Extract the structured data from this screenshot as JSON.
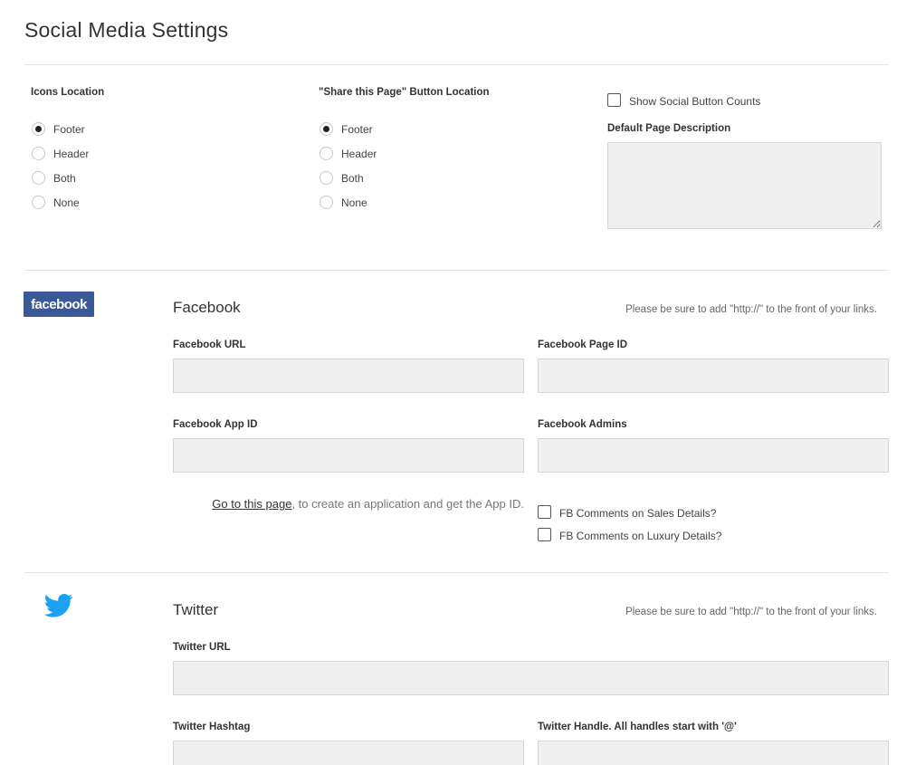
{
  "page": {
    "title": "Social Media Settings"
  },
  "icons_location": {
    "label": "Icons Location",
    "options": [
      "Footer",
      "Header",
      "Both",
      "None"
    ],
    "selected": "Footer"
  },
  "share_location": {
    "label": "\"Share this Page\" Button Location",
    "options": [
      "Footer",
      "Header",
      "Both",
      "None"
    ],
    "selected": "Footer"
  },
  "show_counts": {
    "label": "Show Social Button Counts",
    "checked": false
  },
  "default_description": {
    "label": "Default Page Description",
    "value": ""
  },
  "facebook": {
    "logo_text": "facebook",
    "title": "Facebook",
    "note": "Please be sure to add \"http://\" to the front of your links.",
    "url_label": "Facebook URL",
    "page_id_label": "Facebook Page ID",
    "app_id_label": "Facebook App ID",
    "admins_label": "Facebook Admins",
    "link_text": "Go to this page",
    "link_suffix": ", to create an application and get the App ID.",
    "sales_comments_label": "FB Comments on Sales Details?",
    "luxury_comments_label": "FB Comments on Luxury Details?"
  },
  "twitter": {
    "title": "Twitter",
    "note": "Please be sure to add \"http://\" to the front of your links.",
    "url_label": "Twitter URL",
    "hashtag_label": "Twitter Hashtag",
    "handle_label": "Twitter Handle. All handles start with '@'"
  },
  "colors": {
    "facebook": "#3b5998",
    "twitter": "#1da1f2",
    "input_bg": "#efefef"
  }
}
